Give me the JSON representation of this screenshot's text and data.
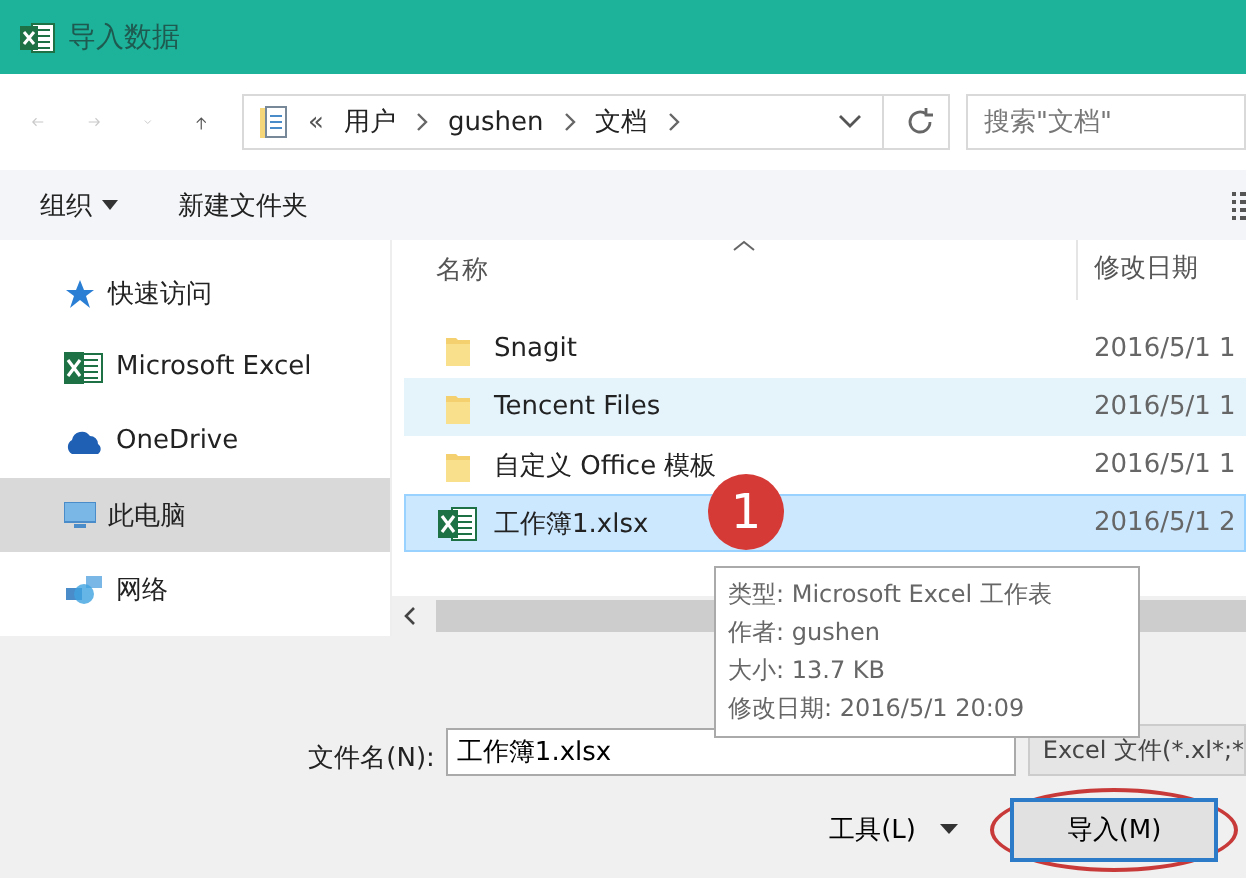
{
  "window": {
    "title": "导入数据"
  },
  "address": {
    "overflow": "«",
    "crumbs": [
      "用户",
      "gushen",
      "文档"
    ]
  },
  "search": {
    "placeholder": "搜索\"文档\""
  },
  "toolbar": {
    "organize": "组织",
    "new_folder": "新建文件夹"
  },
  "sidebar": {
    "items": [
      {
        "kind": "star",
        "label": "快速访问",
        "selected": false
      },
      {
        "kind": "excel",
        "label": "Microsoft Excel",
        "selected": false
      },
      {
        "kind": "cloud",
        "label": "OneDrive",
        "selected": false
      },
      {
        "kind": "computer",
        "label": "此电脑",
        "selected": true
      },
      {
        "kind": "network",
        "label": "网络",
        "selected": false
      }
    ]
  },
  "file_list": {
    "columns": [
      "名称",
      "修改日期"
    ],
    "rows": [
      {
        "kind": "folder",
        "name": "Snagit",
        "date": "2016/5/1 1",
        "selected": false,
        "hovered": false
      },
      {
        "kind": "folder",
        "name": "Tencent Files",
        "date": "2016/5/1 1",
        "selected": false,
        "hovered": true
      },
      {
        "kind": "folder",
        "name": "自定义 Office 模板",
        "date": "2016/5/1 1",
        "selected": false,
        "hovered": false
      },
      {
        "kind": "excel",
        "name": "工作簿1.xlsx",
        "date": "2016/5/1 2",
        "selected": true,
        "hovered": false
      }
    ]
  },
  "annotation_badge": "1",
  "tooltip": [
    "类型: Microsoft Excel 工作表",
    "作者: gushen",
    "大小: 13.7 KB",
    "修改日期: 2016/5/1 20:09"
  ],
  "filename": {
    "label": "文件名(N):",
    "value": "工作簿1.xlsx"
  },
  "filetype": "Excel 文件(*.xl*;*",
  "tools": "工具(L)",
  "import_button": {
    "label": "导入(M)",
    "circled": true
  }
}
